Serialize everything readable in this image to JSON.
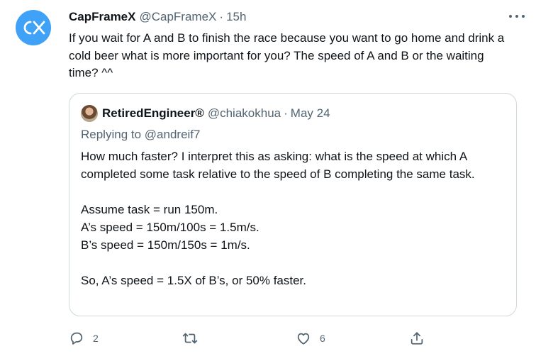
{
  "tweet": {
    "author_name": "CapFrameX",
    "handle": "@CapFrameX",
    "separator": "·",
    "time": "15h",
    "text": "If you wait for A and B to finish the race because you want to go home and drink a cold beer what is more important for you? The speed of A and B or the waiting time? ^^"
  },
  "quoted_tweet": {
    "author_name": "RetiredEngineer®",
    "handle": "@chiakokhua",
    "separator": "·",
    "time": "May 24",
    "replying_prefix": "Replying to",
    "replying_to": "@andreif7",
    "paragraph1": "How much faster? I interpret this as asking: what is the speed at which A completed some task relative to the speed of B completing the same task.",
    "line2": "Assume task = run 150m.",
    "line3": "A’s speed = 150m/100s = 1.5m/s.",
    "line4": "B’s speed = 150m/150s = 1m/s.",
    "line5": "So, A’s speed = 1.5X of B’s, or 50% faster."
  },
  "actions": {
    "reply_count": "2",
    "retweet_count": "",
    "like_count": "6",
    "share_count": ""
  },
  "colors": {
    "avatar_bg": "#3fa2f6",
    "secondary_text": "#536471",
    "border": "#cfd9de"
  },
  "icons": [
    "capframex-logo-icon",
    "more-options-icon",
    "reply-icon",
    "retweet-icon",
    "like-icon",
    "share-icon"
  ]
}
